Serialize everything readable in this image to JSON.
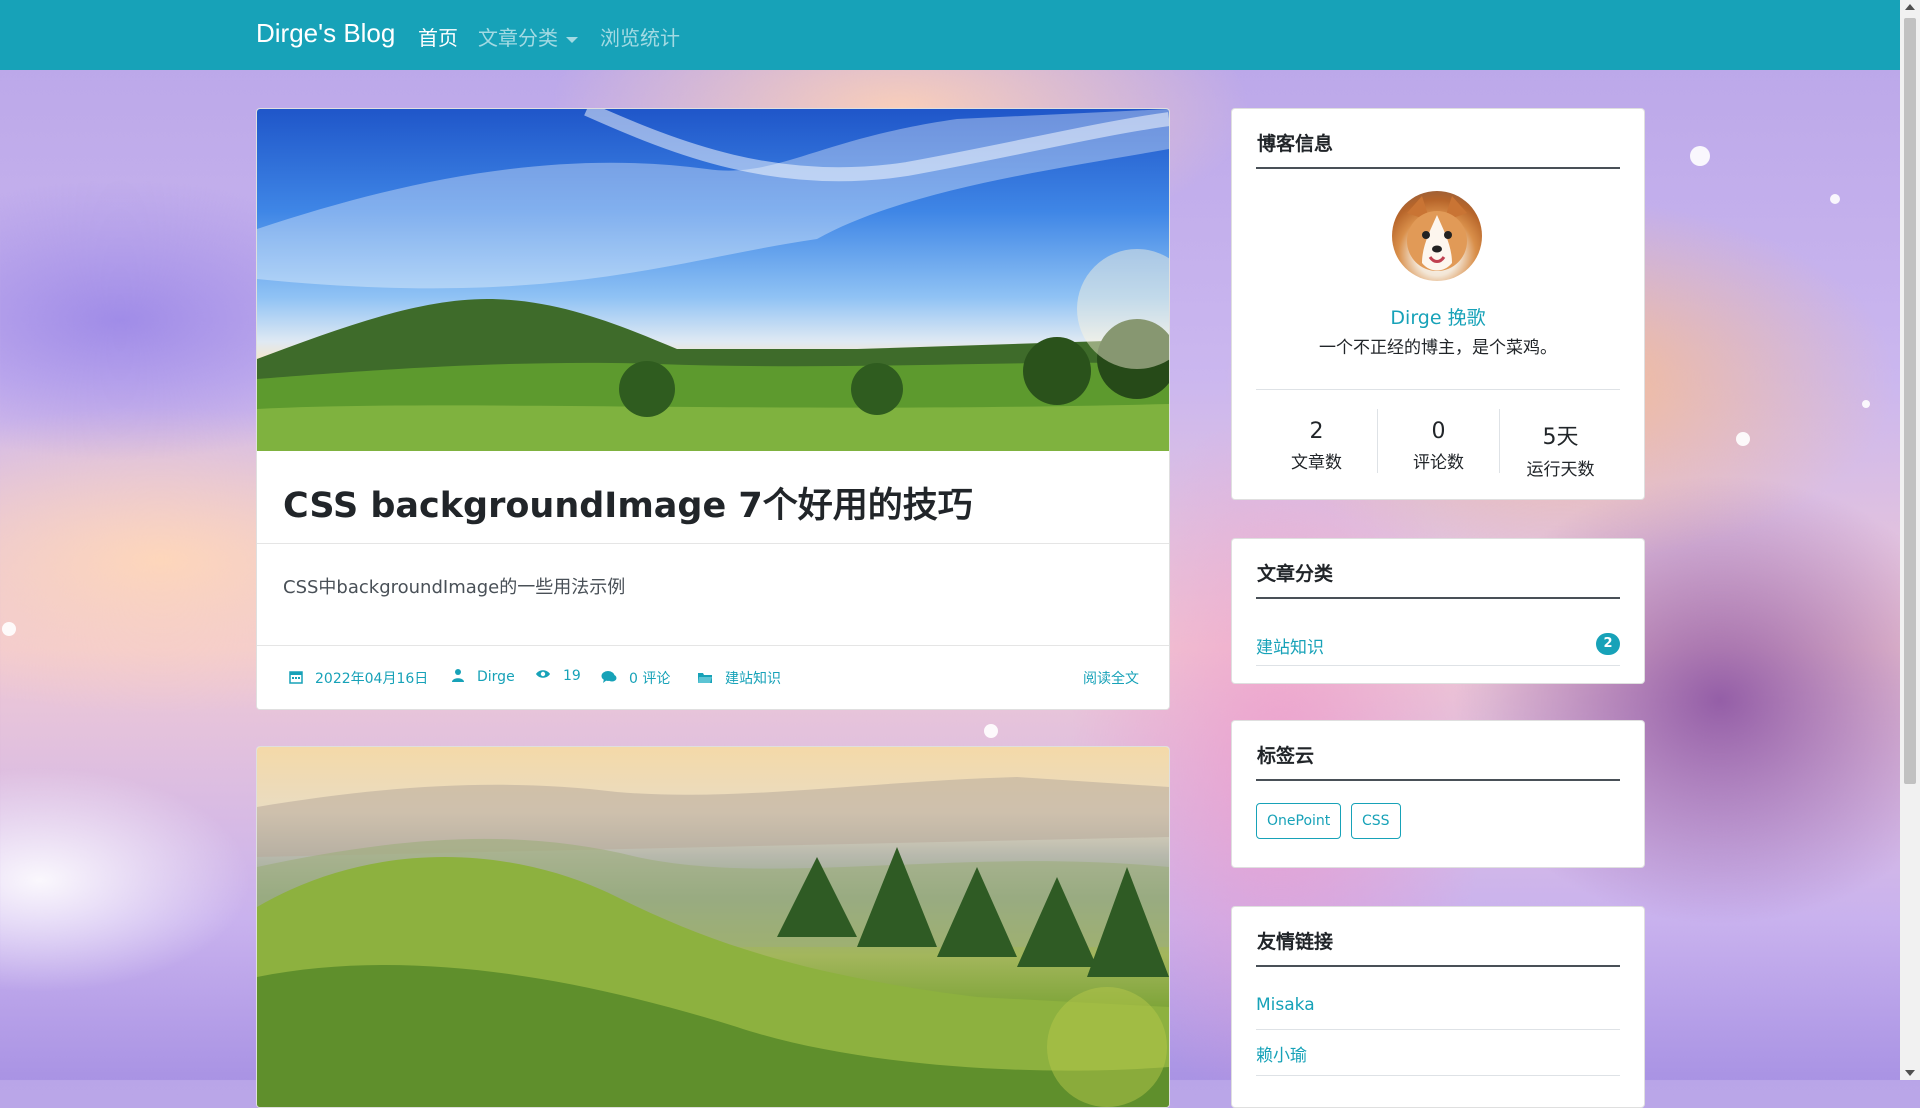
{
  "navbar": {
    "brand": "Dirge's Blog",
    "items": [
      {
        "label": "首页",
        "active": true
      },
      {
        "label": "文章分类",
        "dropdown": true
      },
      {
        "label": "浏览统计"
      }
    ],
    "color": "#17a2b8"
  },
  "posts": [
    {
      "title": "CSS backgroundImage 7个好用的技巧",
      "summary": "CSS中backgroundImage的一些用法示例",
      "meta": {
        "date": "2022年04月16日",
        "author": "Dirge",
        "views": "19",
        "comments": "0 评论",
        "category": "建站知识"
      },
      "read_more": "阅读全文",
      "icons": [
        "calendar-icon",
        "user-icon",
        "eye-icon",
        "comment-icon",
        "folder-icon"
      ]
    }
  ],
  "sidebar": {
    "blog_info": {
      "heading": "博客信息",
      "author_name": "Dirge 挽歌",
      "author_bio": "一个不正经的博主，是个菜鸡。",
      "stats": [
        {
          "value": "2",
          "label": "文章数"
        },
        {
          "value": "0",
          "label": "评论数"
        },
        {
          "value": "5天",
          "label": "运行天数"
        }
      ]
    },
    "categories": {
      "heading": "文章分类",
      "items": [
        {
          "label": "建站知识",
          "count": "2"
        }
      ]
    },
    "tag_cloud": {
      "heading": "标签云",
      "tags": [
        "OnePoint",
        "CSS"
      ]
    },
    "friend_links": {
      "heading": "友情链接",
      "items": [
        "Misaka",
        "赖小瑜"
      ]
    }
  }
}
